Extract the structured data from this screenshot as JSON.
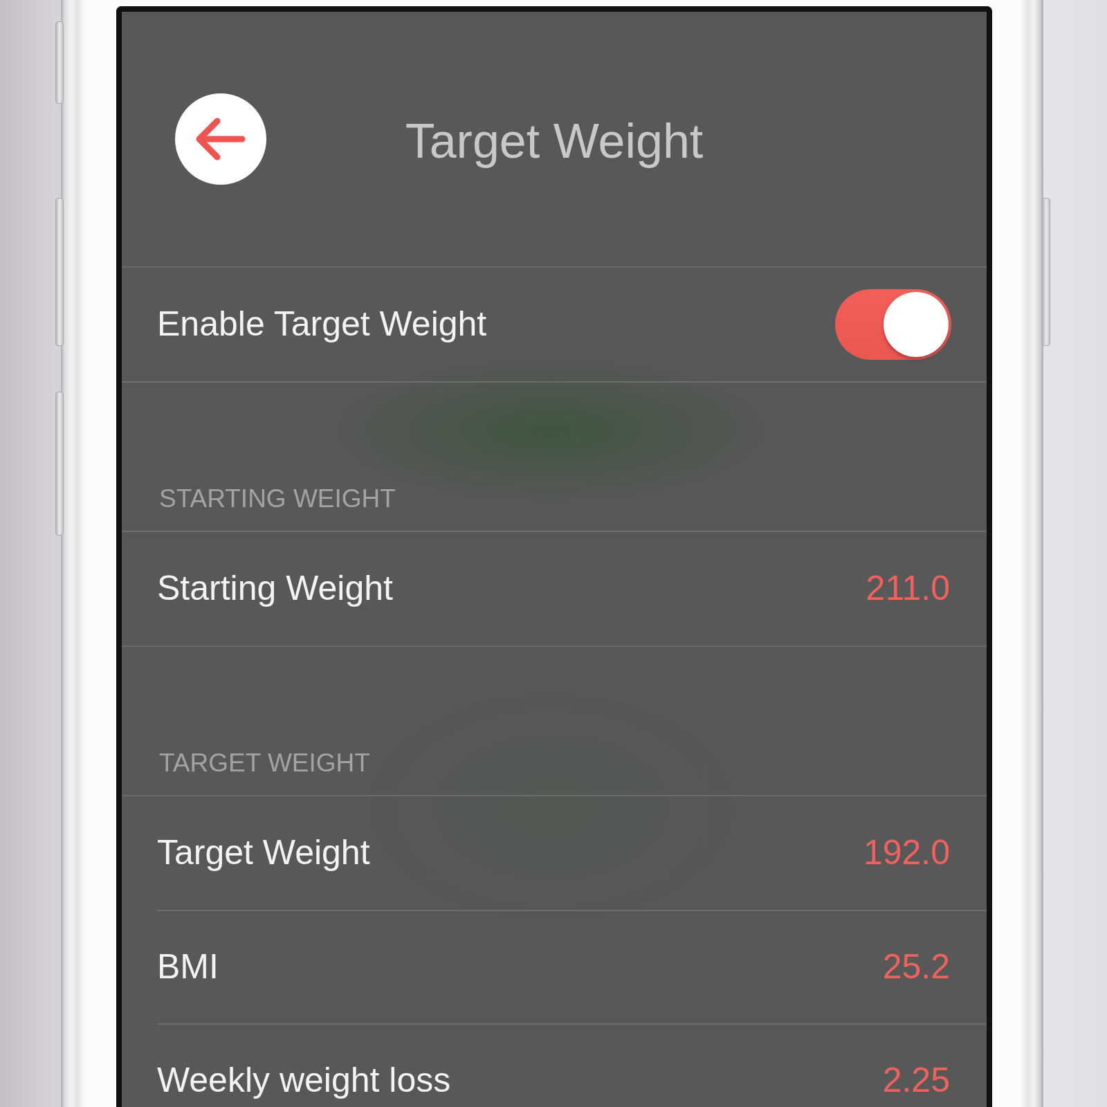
{
  "header": {
    "title": "Target Weight"
  },
  "sections": [
    {
      "rows": [
        {
          "kind": "toggle",
          "label": "Enable Target Weight",
          "on": true
        }
      ]
    },
    {
      "title": "STARTING WEIGHT",
      "rows": [
        {
          "kind": "value",
          "label": "Starting Weight",
          "value": "211.0"
        }
      ]
    },
    {
      "title": "TARGET WEIGHT",
      "rows": [
        {
          "kind": "value",
          "label": "Target Weight",
          "value": "192.0"
        },
        {
          "kind": "value",
          "label": "BMI",
          "value": "25.2"
        },
        {
          "kind": "value",
          "label": "Weekly weight loss",
          "value": "2.25"
        }
      ]
    }
  ]
}
